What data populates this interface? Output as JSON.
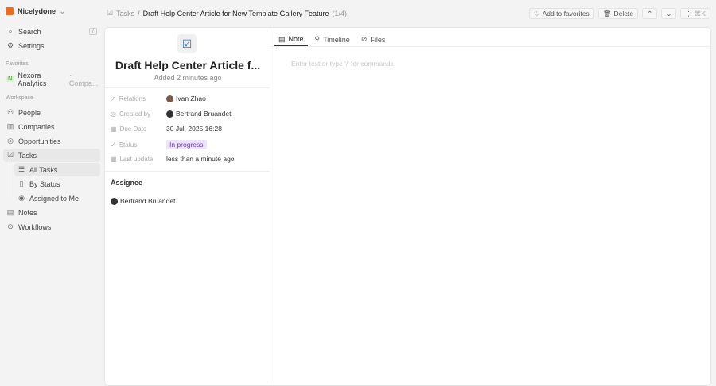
{
  "workspace": {
    "name": "Nicelydone"
  },
  "sidebar": {
    "search": "Search",
    "search_key": "/",
    "settings": "Settings",
    "favorites_label": "Favorites",
    "favorite": {
      "badge": "N",
      "name": "Nexora Analytics",
      "type": "· Compa..."
    },
    "workspace_label": "Workspace",
    "items": [
      "People",
      "Companies",
      "Opportunities",
      "Tasks"
    ],
    "subitems": [
      "All Tasks",
      "By Status",
      "Assigned to Me"
    ],
    "items2": [
      "Notes",
      "Workflows"
    ]
  },
  "breadcrumb": {
    "parent": "Tasks",
    "sep": "/",
    "current": "Draft Help Center Article for New Template Gallery Feature",
    "count": "(1/4)"
  },
  "toolbar": {
    "favorite": "Add to favorites",
    "delete": "Delete",
    "shortcut": "⌘K"
  },
  "record": {
    "title": "Draft Help Center Article f...",
    "added": "Added 2 minutes ago",
    "fields": [
      {
        "label": "Relations",
        "value": "Ivan Zhao"
      },
      {
        "label": "Created by",
        "value": "Bertrand Bruandet"
      },
      {
        "label": "Due Date",
        "value": "30 Jul, 2025 16:28"
      },
      {
        "label": "Status",
        "value": "In progress"
      },
      {
        "label": "Last update",
        "value": "less than a minute ago"
      }
    ],
    "assignee_label": "Assignee",
    "assignee": "Bertrand Bruandet"
  },
  "tabs": [
    "Note",
    "Timeline",
    "Files"
  ],
  "editor": {
    "placeholder": "Enter text or type '/' for commands"
  }
}
